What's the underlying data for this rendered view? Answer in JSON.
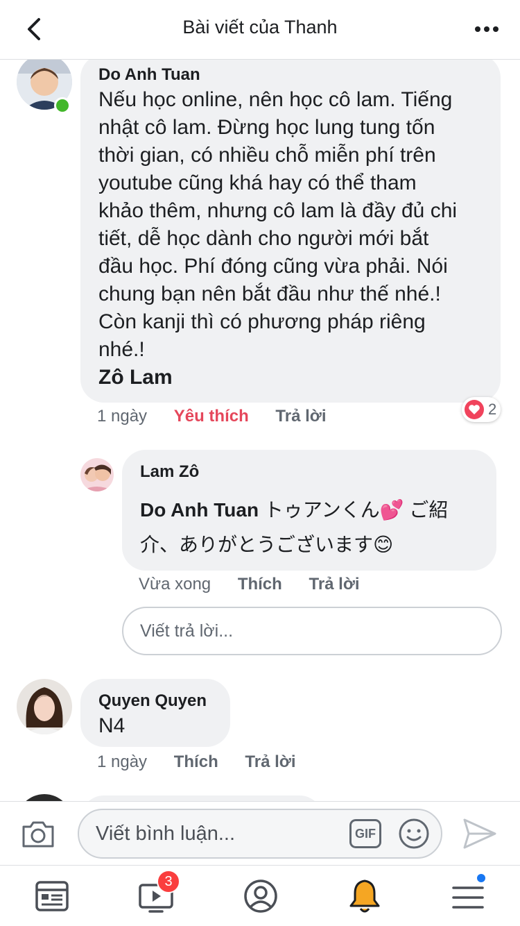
{
  "header": {
    "title": "Bài viết của Thanh",
    "back_icon": "chevron-left-icon",
    "more_icon": "more-dots-icon"
  },
  "comments": [
    {
      "author": "Do Anh Tuan",
      "online": true,
      "text_lines": [
        "Nếu học online, nên học cô lam. Tiếng",
        "nhật cô lam. Đừng học lung tung tốn",
        "thời gian, có nhiều chỗ miễn phí trên",
        "youtube cũng khá hay có thể tham",
        "khảo thêm, nhưng cô lam là đầy đủ chi",
        "tiết, dễ học dành cho người mới bắt",
        "đầu học. Phí đóng cũng vừa phải. Nói",
        "chung bạn nên bắt đầu như thế nhé.!",
        "Còn kanji thì có phương pháp riêng",
        "nhé.!"
      ],
      "mention": "Zô Lam",
      "time": "1 ngày",
      "like_label": "Yêu thích",
      "reply_label": "Trả lời",
      "reaction": {
        "type": "love",
        "count": "2"
      }
    },
    {
      "author": "Quyen Quyen",
      "text": "N4",
      "time": "1 ngày",
      "like_label": "Thích",
      "reply_label": "Trả lời"
    }
  ],
  "reply": {
    "author": "Lam Zô",
    "mention": "Do Anh Tuan",
    "line1": "トゥアンくん💕 ご紹",
    "line2": "介、ありがとうございます😊",
    "time": "Vừa xong",
    "like_label": "Thích",
    "reply_label": "Trả lời"
  },
  "reply_input": {
    "placeholder": "Viết trả lời..."
  },
  "composer": {
    "placeholder": "Viết bình luận...",
    "gif_label": "GIF",
    "camera_icon": "camera-icon",
    "emoji_icon": "smiley-icon",
    "send_icon": "send-icon"
  },
  "tabbar": {
    "tabs": [
      "news-feed-icon",
      "watch-icon",
      "profile-icon",
      "notifications-icon",
      "menu-icon"
    ],
    "watch_badge": "3"
  },
  "colors": {
    "accent_like": "#e5475b",
    "bubble": "#f0f1f3",
    "online": "#42b72a",
    "badge": "#fa3e3e",
    "bell": "#f5a623"
  }
}
